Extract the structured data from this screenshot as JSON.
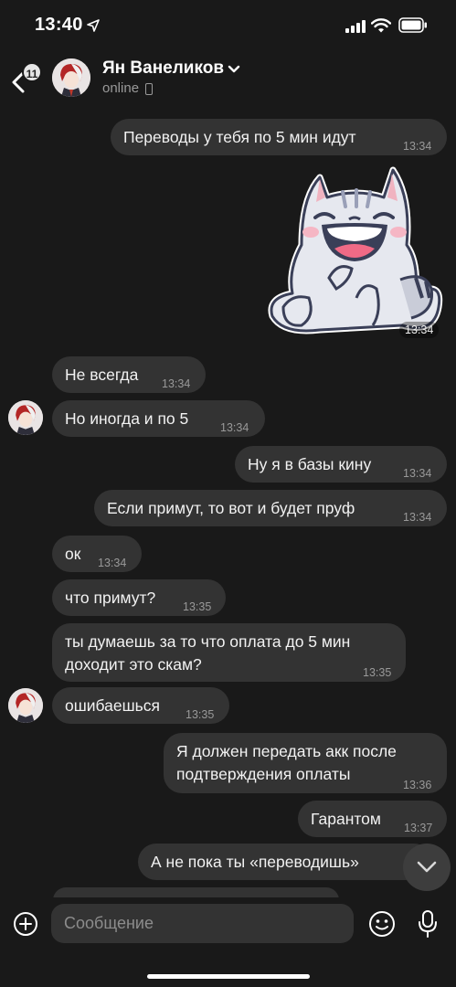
{
  "status_bar": {
    "time": "13:40"
  },
  "header": {
    "back_badge": "11",
    "contact_name": "Ян Ванеликов",
    "contact_status": "online"
  },
  "messages": [
    {
      "side": "out",
      "text": "Переводы у тебя по 5 мин идут",
      "time": "13:34"
    },
    {
      "side": "out",
      "type": "sticker",
      "sticker": "laughing-cat-sticker",
      "time": "13:34"
    },
    {
      "side": "in",
      "text": "Не всегда",
      "time": "13:34"
    },
    {
      "side": "in",
      "text": "Но иногда и по 5",
      "time": "13:34"
    },
    {
      "side": "out",
      "text": "Ну я в базы кину",
      "time": "13:34"
    },
    {
      "side": "out",
      "text": "Если примут, то вот и будет пруф",
      "time": "13:34"
    },
    {
      "side": "in",
      "text": "ок",
      "time": "13:34"
    },
    {
      "side": "in",
      "text": "что примут?",
      "time": "13:35"
    },
    {
      "side": "in",
      "text": "ты думаешь за то что оплата до 5 мин доходит это скам?",
      "time": "13:35"
    },
    {
      "side": "in",
      "text": "ошибаешься",
      "time": "13:35"
    },
    {
      "side": "out",
      "text": "Я должен передать акк после подтверждения оплаты",
      "time": "13:36"
    },
    {
      "side": "out",
      "text": "Гарантом",
      "time": "13:37"
    },
    {
      "side": "out",
      "text": "А не пока ты «переводишь»",
      "time": ""
    }
  ],
  "composer": {
    "placeholder": "Сообщение"
  },
  "colors": {
    "background": "#191919",
    "bubble": "#333333",
    "time_text": "#999999",
    "status_text": "#9a9a9a"
  }
}
